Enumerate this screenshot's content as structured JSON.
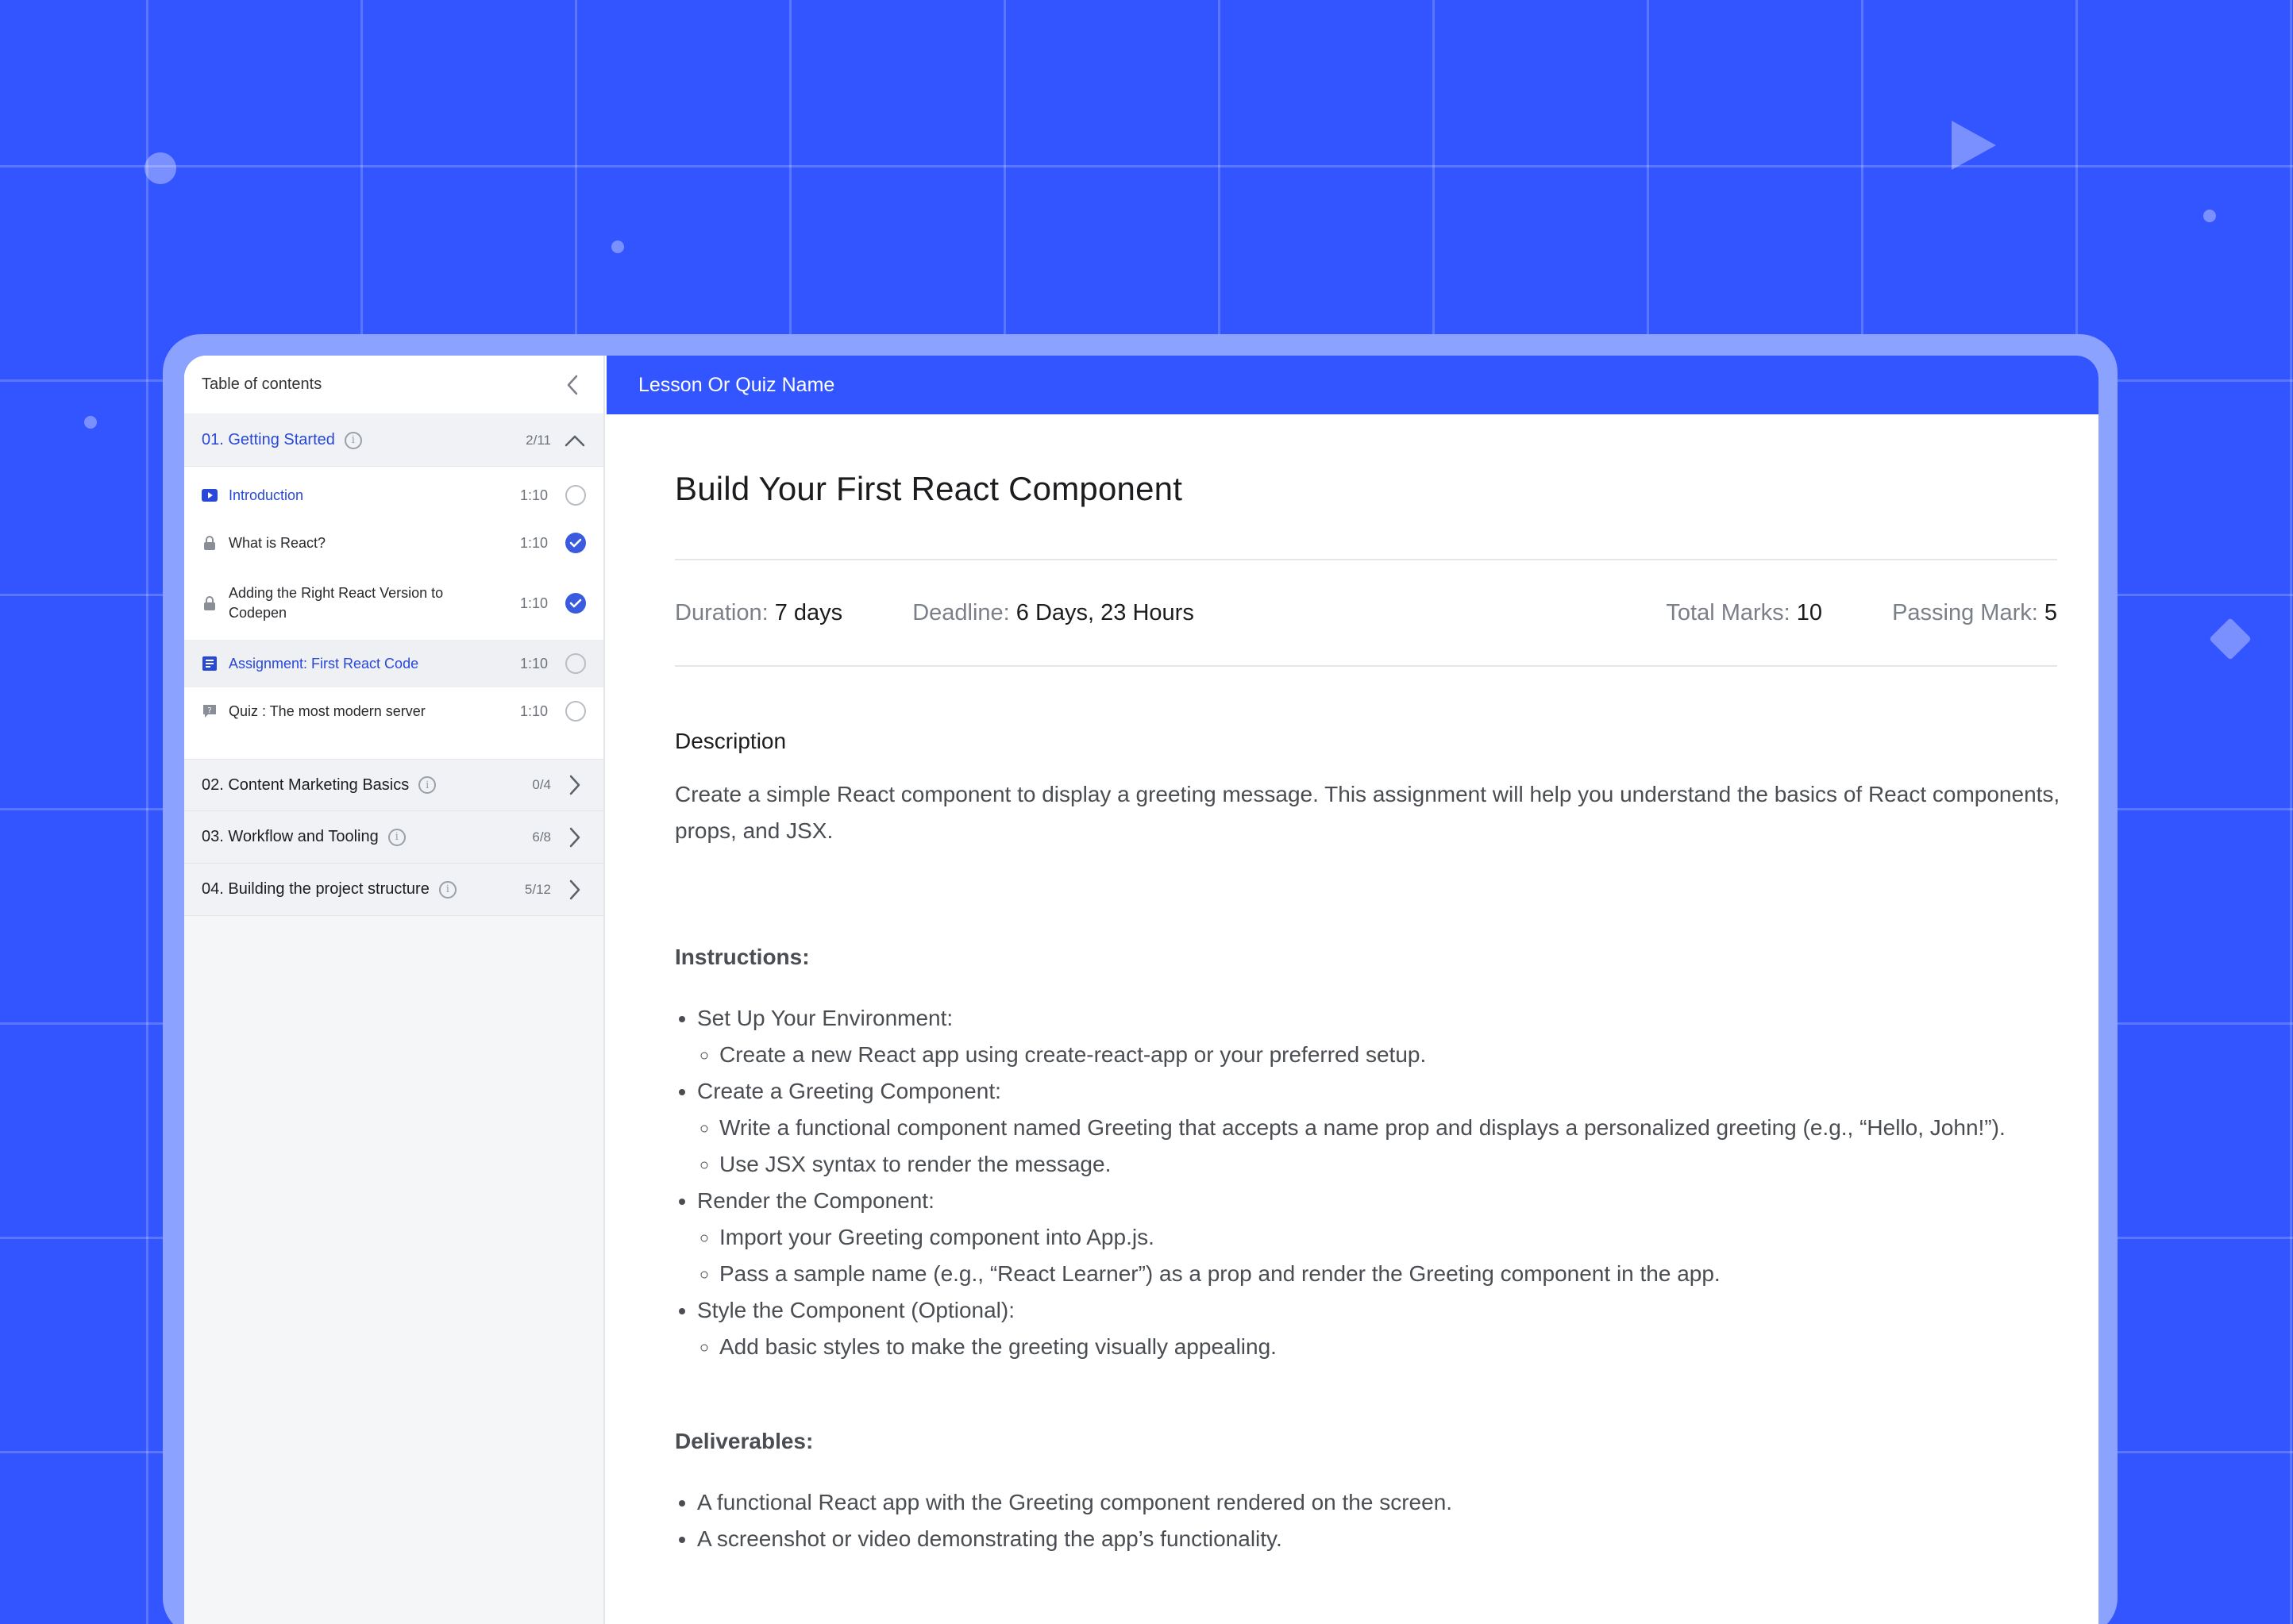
{
  "sidebar": {
    "title": "Table of contents",
    "sections": [
      {
        "name": "01. Getting Started",
        "count": "2/11",
        "expanded": true,
        "lessons": [
          {
            "name": "Introduction",
            "time": "1:10",
            "type": "video",
            "status": "incomplete",
            "current": true
          },
          {
            "name": "What is React?",
            "time": "1:10",
            "type": "locked",
            "status": "complete"
          },
          {
            "name": "Adding the Right React Version to Codepen",
            "time": "1:10",
            "type": "locked",
            "status": "complete"
          },
          {
            "name": "Assignment: First React Code",
            "time": "1:10",
            "type": "assignment",
            "status": "incomplete"
          },
          {
            "name": "Quiz : The most modern server",
            "time": "1:10",
            "type": "quiz",
            "status": "incomplete"
          }
        ]
      },
      {
        "name": "02. Content Marketing Basics",
        "count": "0/4"
      },
      {
        "name": "03. Workflow and Tooling",
        "count": "6/8"
      },
      {
        "name": "04. Building the project structure",
        "count": "5/12"
      }
    ]
  },
  "topbar": {
    "title": "Lesson Or Quiz Name"
  },
  "lesson": {
    "title": "Build Your First React Component",
    "meta": {
      "duration_label": "Duration:",
      "duration": "7 days",
      "deadline_label": "Deadline:",
      "deadline": "6 Days, 23 Hours",
      "total_label": "Total Marks:",
      "total": "10",
      "passing_label": "Passing Mark:",
      "passing": "5"
    },
    "description_title": "Description",
    "description": "Create a simple React component to display a greeting message. This assignment will help you understand the basics of React components, props, and JSX.",
    "instructions_title": "Instructions:",
    "instructions": [
      {
        "text": "Set Up Your Environment:",
        "sub": [
          "Create a new React app using create-react-app or your preferred setup."
        ]
      },
      {
        "text": "Create a Greeting Component:",
        "sub": [
          "Write a functional component named Greeting that accepts a name prop and displays a personalized greeting (e.g., “Hello, John!”).",
          "Use JSX syntax to render the message."
        ]
      },
      {
        "text": "Render the Component:",
        "sub": [
          "Import your Greeting component into App.js.",
          "Pass a sample name (e.g., “React Learner”) as a prop and render the Greeting component in the app."
        ]
      },
      {
        "text": "Style the Component (Optional):",
        "sub": [
          "Add basic styles to make the greeting visually appealing."
        ]
      }
    ],
    "deliverables_title": "Deliverables:",
    "deliverables": [
      "A functional React app with the Greeting component rendered on the screen.",
      "A screenshot or video demonstrating the app’s functionality."
    ]
  },
  "colors": {
    "brand": "#3355ff",
    "accent_text": "#2848d8",
    "check": "#3a5be0"
  }
}
